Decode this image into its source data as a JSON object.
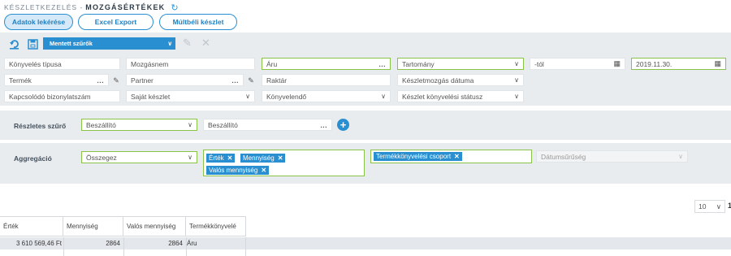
{
  "header": {
    "module": "KÉSZLETKEZELÉS -",
    "title": "MOZGÁSÉRTÉKEK",
    "refresh_icon": "refresh-icon"
  },
  "actions": {
    "query": "Adatok lekérése",
    "excel": "Excel Export",
    "history": "Múltbéli készlet"
  },
  "toolbar": {
    "saved_filters": "Mentett szűrők"
  },
  "filters": {
    "row1": {
      "booking_type": "Könyvelés típusa",
      "movement_name": "Mozgásnem",
      "goods": "Áru",
      "range": "Tartomány",
      "from": "-tól",
      "to_date": "2019.11.30."
    },
    "row2": {
      "product": "Termék",
      "partner": "Partner",
      "warehouse": "Raktár",
      "movement_date": "Készletmozgás dátuma"
    },
    "row3": {
      "related_doc": "Kapcsolódó bizonylatszám",
      "own_stock": "Saját készlet",
      "bookable": "Könyvelendő",
      "booking_status": "Készlet könyvelési státusz"
    }
  },
  "detail_filter": {
    "label": "Részletes szűrő",
    "select": "Beszállító",
    "value": "Beszállító"
  },
  "aggregation": {
    "label": "Aggregáció",
    "select": "Összegez",
    "tags": [
      "Érték",
      "Mennyiség",
      "Valós mennyiség"
    ],
    "group_tags": [
      "Termékkönyvelési csoport"
    ],
    "date_granularity": "Dátumsűrűség"
  },
  "results": {
    "page_size": "10",
    "page": "1",
    "columns": [
      "Érték",
      "Mennyiség",
      "Valós mennyiség",
      "Termékkönyvelé"
    ],
    "rows": [
      [
        "3 610 569,46 Ft",
        "2864",
        "2864",
        "Áru"
      ]
    ]
  },
  "colors": {
    "accent": "#2a8fd0",
    "valid_border": "#8bc34a",
    "panel_bg": "#e9ecef"
  }
}
